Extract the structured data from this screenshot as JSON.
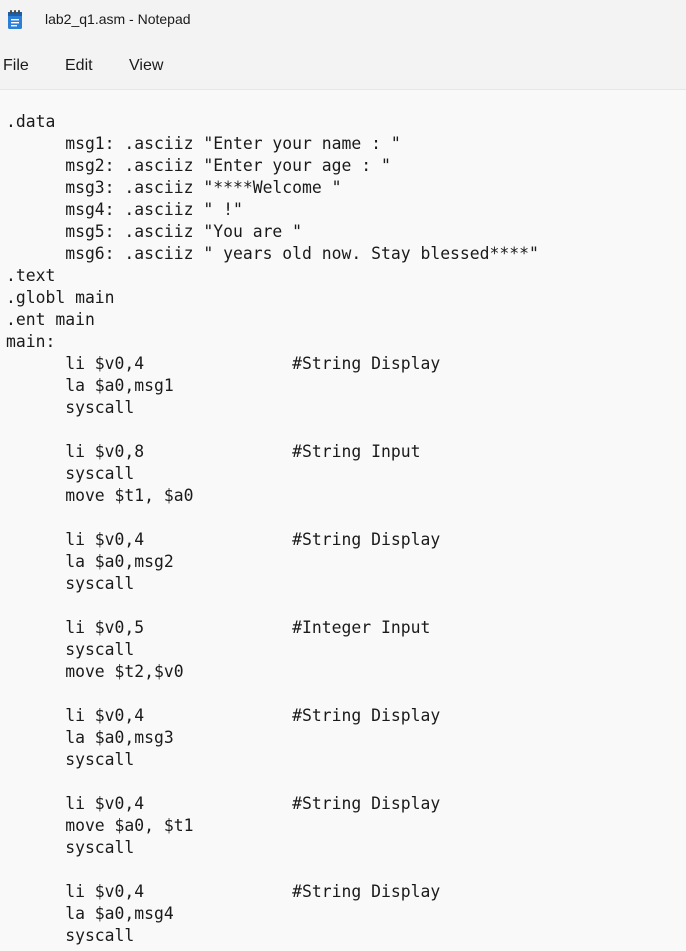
{
  "window": {
    "title": "lab2_q1.asm - Notepad",
    "icon": "notepad-icon"
  },
  "menu": {
    "items": [
      "File",
      "Edit",
      "View"
    ]
  },
  "editor": {
    "lines": [
      ".data",
      "      msg1: .asciiz \"Enter your name : \"",
      "      msg2: .asciiz \"Enter your age : \"",
      "      msg3: .asciiz \"****Welcome \"",
      "      msg4: .asciiz \" !\"",
      "      msg5: .asciiz \"You are \"",
      "      msg6: .asciiz \" years old now. Stay blessed****\"",
      ".text",
      ".globl main",
      ".ent main",
      "main:",
      "      li $v0,4               #String Display",
      "      la $a0,msg1",
      "      syscall",
      "",
      "      li $v0,8               #String Input",
      "      syscall",
      "      move $t1, $a0",
      "",
      "      li $v0,4               #String Display",
      "      la $a0,msg2",
      "      syscall",
      "",
      "      li $v0,5               #Integer Input",
      "      syscall",
      "      move $t2,$v0",
      "",
      "      li $v0,4               #String Display",
      "      la $a0,msg3",
      "      syscall",
      "",
      "      li $v0,4               #String Display",
      "      move $a0, $t1",
      "      syscall",
      "",
      "      li $v0,4               #String Display",
      "      la $a0,msg4",
      "      syscall"
    ]
  }
}
